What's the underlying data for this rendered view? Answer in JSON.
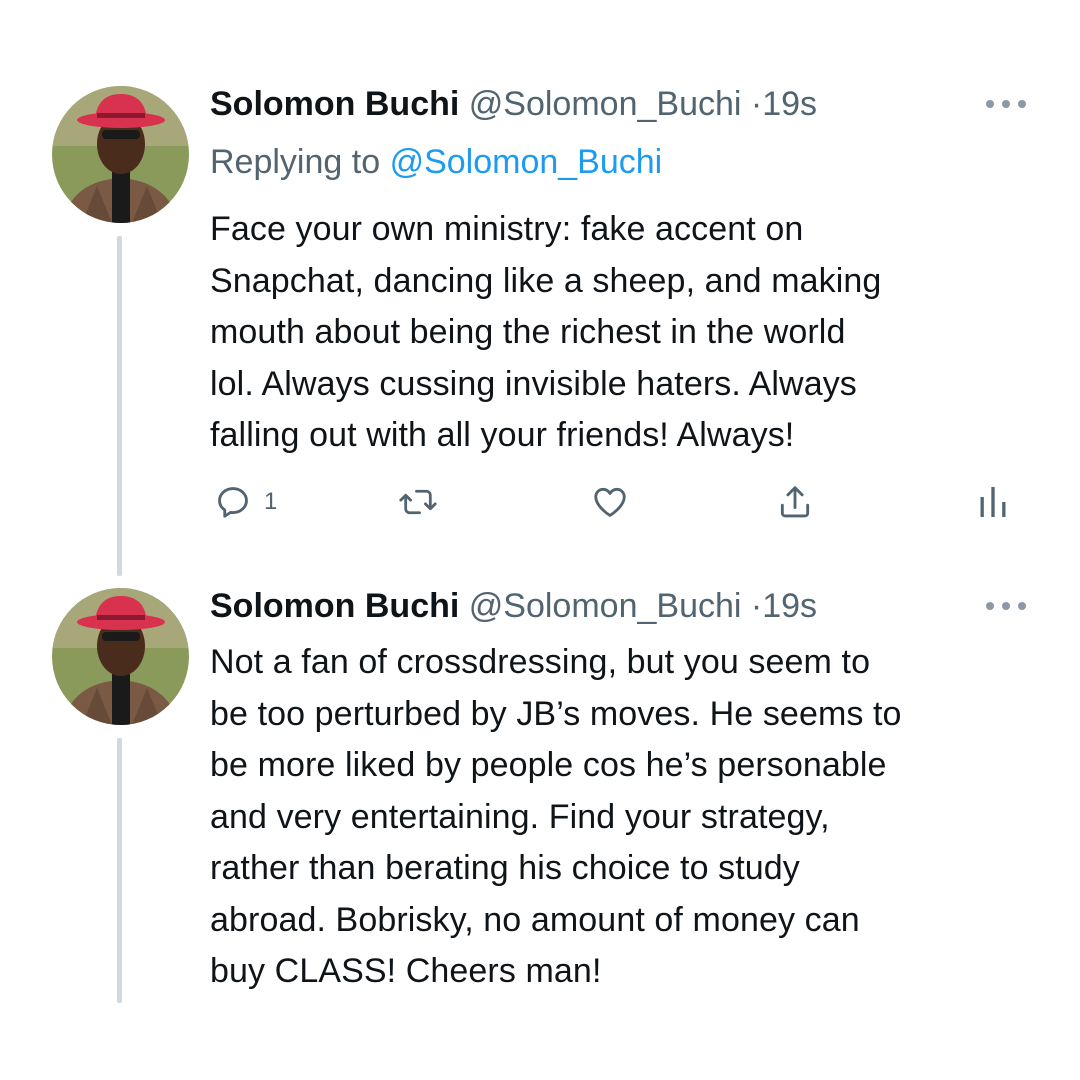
{
  "tweets": [
    {
      "author_name": "Solomon Buchi",
      "handle": "@Solomon_Buchi",
      "separator": "·",
      "time": "19s",
      "replying_label": "Replying to",
      "replying_to": "@Solomon_Buchi",
      "lines": [
        "Face your own ministry: fake accent on",
        "Snapchat, dancing like a sheep, and making",
        "mouth about being the richest in the world",
        "lol. Always cussing invisible haters. Always",
        "falling out with all your friends! Always!"
      ],
      "reply_count": "1",
      "icons": [
        "reply-icon",
        "retweet-icon",
        "like-icon",
        "share-icon",
        "analytics-icon"
      ]
    },
    {
      "author_name": "Solomon Buchi",
      "handle": "@Solomon_Buchi",
      "separator": "·",
      "time": "19s",
      "lines": [
        "Not a fan of crossdressing, but you seem to",
        "be too perturbed by JB’s moves. He seems to",
        "be more liked by people cos he’s personable",
        "and very entertaining. Find your strategy,",
        "rather than berating his choice to study",
        "abroad. Bobrisky, no amount of money can",
        "buy CLASS! Cheers man!"
      ]
    }
  ],
  "colors": {
    "text": "#0f1419",
    "secondary": "#536471",
    "link": "#1d9bf0",
    "thread_line": "#cfd9de",
    "hat": "#d8324f"
  }
}
